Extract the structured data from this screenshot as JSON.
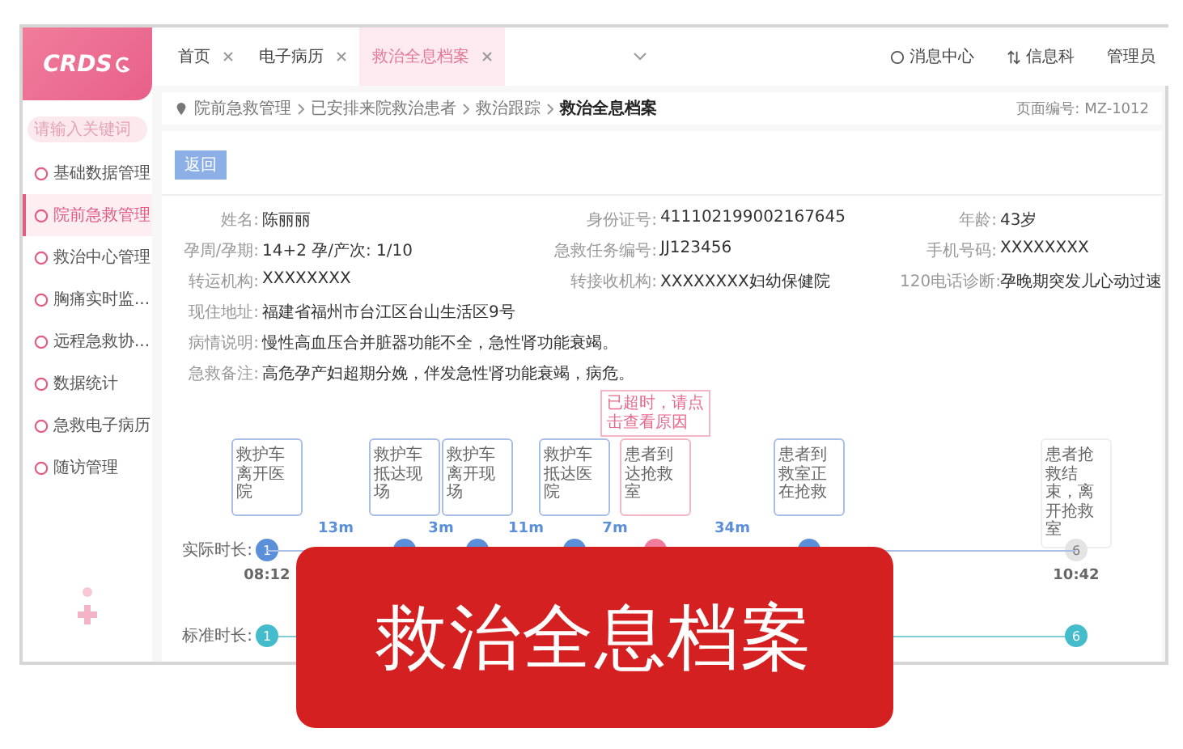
{
  "logo": "CRDS",
  "sidebar": {
    "search": {
      "placeholder": "请输入关键词"
    },
    "items": [
      {
        "label": "基础数据管理",
        "selected": false
      },
      {
        "label": "院前急救管理",
        "selected": true
      },
      {
        "label": "救治中心管理",
        "selected": false
      },
      {
        "label": "胸痛实时监...",
        "selected": false
      },
      {
        "label": "远程急救协...",
        "selected": false
      },
      {
        "label": "数据统计",
        "selected": false
      },
      {
        "label": "急救电子病历",
        "selected": false
      },
      {
        "label": "随访管理",
        "selected": false
      }
    ]
  },
  "tabs": [
    {
      "label": "首页",
      "selected": false
    },
    {
      "label": "电子病历",
      "selected": false
    },
    {
      "label": "救治全息档案",
      "selected": true
    }
  ],
  "header_actions": [
    "消息中心",
    "信息科",
    "管理员"
  ],
  "breadcrumb": [
    "院前急救管理",
    "已安排来院救治患者",
    "救治跟踪",
    "救治全息档案"
  ],
  "page_number": "页面编号: MZ-1012",
  "back_button": "返回",
  "fields": [
    [
      {
        "label": "姓名:",
        "value": "陈丽丽"
      },
      {
        "label": "身份证号:",
        "value": "411102199002167645"
      },
      {
        "label": "年龄:",
        "value": "43岁"
      }
    ],
    [
      {
        "label": "孕周/孕期:",
        "value": "14+2 孕/产次: 1/10"
      },
      {
        "label": "急救任务编号:",
        "value": "JJ123456"
      },
      {
        "label": "手机号码:",
        "value": "XXXXXXXX"
      }
    ],
    [
      {
        "label": "转运机构:",
        "value": "XXXXXXXX"
      },
      {
        "label": "转接收机构:",
        "value": "XXXXXXXX妇幼保健院"
      },
      {
        "label": "120电话诊断:",
        "value": "孕晚期突发儿心动过速"
      }
    ],
    [
      {
        "label": "现住地址:",
        "value": "福建省福州市台江区台山生活区9号"
      }
    ],
    [
      {
        "label": "病情说明:",
        "value": "慢性高血压合并脏器功能不全，急性肾功能衰竭。"
      }
    ],
    [
      {
        "label": "急救备注:",
        "value": "高危孕产妇超期分娩，伴发急性肾功能衰竭，病危。"
      }
    ]
  ],
  "timeline": {
    "actual_label": "实际时长:",
    "standard_label": "标准时长:",
    "events": [
      {
        "kind": "done",
        "note": "救护车离开医院",
        "node": "1",
        "time": "08:12"
      },
      {
        "kind": "done",
        "note": "救护车抵达现场",
        "duration": "13m"
      },
      {
        "kind": "done",
        "note": "救护车离开现场",
        "duration": "3m"
      },
      {
        "kind": "done",
        "note": "救护车抵达医院",
        "duration": "11m"
      },
      {
        "kind": "late",
        "note": "患者到达抢救室",
        "warning": "已超时，请点击查看原因",
        "duration": "7m"
      },
      {
        "kind": "done",
        "note": "患者到救室正在抢救",
        "duration": "34m"
      },
      {
        "kind": "pending",
        "note": "患者抢救结束，离开抢救室",
        "node": "6",
        "time": "10:42"
      }
    ],
    "standard_nodes": [
      {
        "node": "1"
      },
      {
        "node": "6"
      }
    ]
  },
  "banner": "救治全息档案"
}
